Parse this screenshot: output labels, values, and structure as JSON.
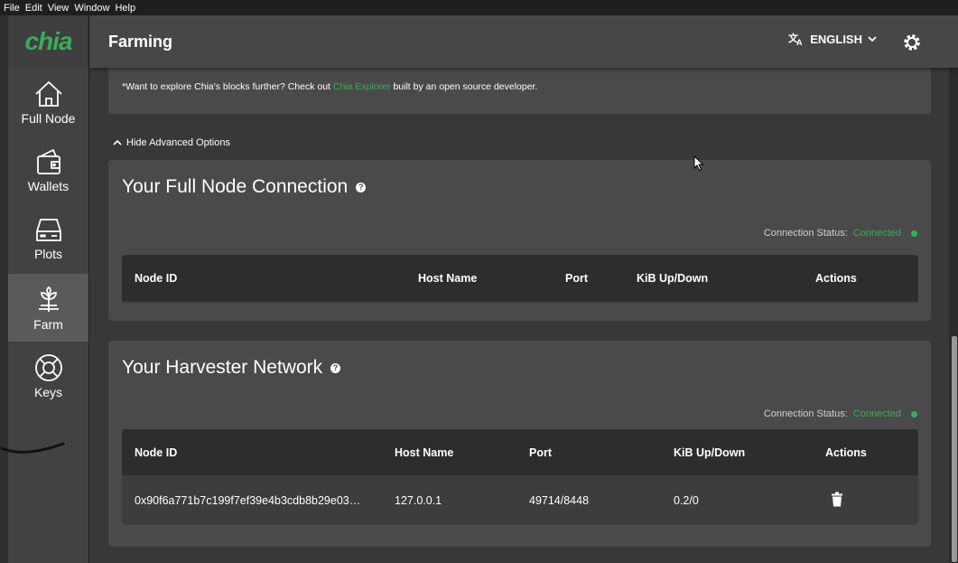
{
  "menubar": {
    "items": [
      "File",
      "Edit",
      "View",
      "Window",
      "Help"
    ]
  },
  "sidebar": {
    "logo": "chia",
    "items": [
      {
        "label": "Full Node",
        "icon": "home-icon",
        "active": false
      },
      {
        "label": "Wallets",
        "icon": "wallet-icon",
        "active": false
      },
      {
        "label": "Plots",
        "icon": "hard-drive-icon",
        "active": false
      },
      {
        "label": "Farm",
        "icon": "sprout-icon",
        "active": true
      },
      {
        "label": "Keys",
        "icon": "lifebuoy-icon",
        "active": false
      }
    ]
  },
  "header": {
    "title": "Farming",
    "language": "ENGLISH"
  },
  "info": {
    "text_before": "*Want to explore Chia's blocks further? Check out ",
    "link": "Chia Explorer",
    "text_after": " built by an open source developer."
  },
  "advanced_toggle": "Hide Advanced Options",
  "full_node_connection": {
    "title": "Your Full Node Connection",
    "status_label": "Connection Status:",
    "status_value": "Connected",
    "columns": [
      "Node ID",
      "Host Name",
      "Port",
      "KiB Up/Down",
      "Actions"
    ]
  },
  "harvester_network": {
    "title": "Your Harvester Network",
    "status_label": "Connection Status:",
    "status_value": "Connected",
    "columns": [
      "Node ID",
      "Host Name",
      "Port",
      "KiB Up/Down",
      "Actions"
    ],
    "rows": [
      {
        "node_id": "0x90f6a771b7c199f7ef39e4b3cdb8b29e03…",
        "host": "127.0.0.1",
        "port": "49714/8448",
        "kib": "0.2/0",
        "action_icon": "trash-icon"
      }
    ]
  },
  "colors": {
    "accent": "#3aac59",
    "background": "#383838",
    "card": "#4a4a4a",
    "header": "#474747"
  }
}
